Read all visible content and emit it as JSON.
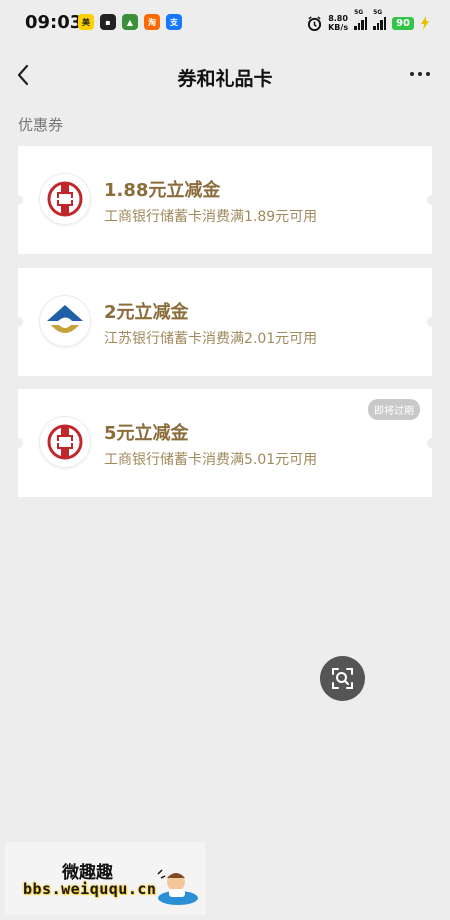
{
  "status_bar": {
    "time": "09:03",
    "net_speed_value": "8.80",
    "net_speed_unit": "KB/s",
    "signal_1_label": "5G",
    "signal_2_label": "5G",
    "battery": "90",
    "app_icons": [
      "meituan-icon",
      "dark-app-icon",
      "game-app-icon",
      "taobao-icon",
      "alipay-icon"
    ]
  },
  "header": {
    "title": "券和礼品卡"
  },
  "section": {
    "label": "优惠券"
  },
  "coupons": [
    {
      "title": "1.88元立减金",
      "desc": "工商银行储蓄卡消费满1.89元可用",
      "bank_logo": "icbc-logo"
    },
    {
      "title": "2元立减金",
      "desc": "江苏银行储蓄卡消费满2.01元可用",
      "bank_logo": "jiangsu-bank-logo"
    },
    {
      "title": "5元立减金",
      "desc": "工商银行储蓄卡消费满5.01元可用",
      "bank_logo": "icbc-logo",
      "badge": "即将过期"
    }
  ],
  "watermark": {
    "name": "微趣趣",
    "url": "bbs.weiququ.cn"
  },
  "colors": {
    "background": "#ededed",
    "coupon_title": "#8a6d3b",
    "coupon_desc": "#a08a5c",
    "icbc_red": "#c0272d",
    "jiangsu_blue": "#1f5fa8",
    "jiangsu_gold": "#c9a13a"
  }
}
